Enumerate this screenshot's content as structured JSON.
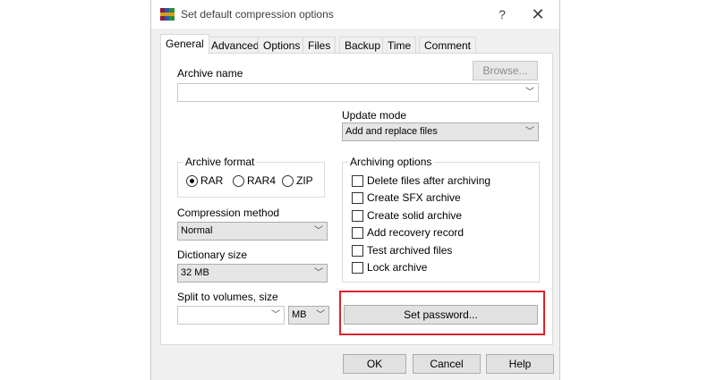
{
  "window": {
    "title": "Set default compression options",
    "help_glyph": "?",
    "close_glyph": "✕",
    "icon": "winrar-books-icon"
  },
  "tabs": [
    {
      "label": "General",
      "active": true
    },
    {
      "label": "Advanced",
      "active": false
    },
    {
      "label": "Options",
      "active": false
    },
    {
      "label": "Files",
      "active": false
    },
    {
      "label": "Backup",
      "active": false
    },
    {
      "label": "Time",
      "active": false
    },
    {
      "label": "Comment",
      "active": false
    }
  ],
  "general": {
    "archive_name_label": "Archive name",
    "archive_name_value": "",
    "browse_label": "Browse...",
    "update_mode_label": "Update mode",
    "update_mode_value": "Add and replace files",
    "archive_format": {
      "title": "Archive format",
      "options": [
        "RAR",
        "RAR4",
        "ZIP"
      ],
      "selected": "RAR"
    },
    "compression_method_label": "Compression method",
    "compression_method_value": "Normal",
    "dictionary_size_label": "Dictionary size",
    "dictionary_size_value": "32 MB",
    "split_label": "Split to volumes, size",
    "split_value": "",
    "split_unit": "MB",
    "archiving_options": {
      "title": "Archiving options",
      "items": [
        {
          "label": "Delete files after archiving",
          "checked": false
        },
        {
          "label": "Create SFX archive",
          "checked": false
        },
        {
          "label": "Create solid archive",
          "checked": false
        },
        {
          "label": "Add recovery record",
          "checked": false
        },
        {
          "label": "Test archived files",
          "checked": false
        },
        {
          "label": "Lock archive",
          "checked": false
        }
      ]
    },
    "set_password_label": "Set password..."
  },
  "footer": {
    "ok_label": "OK",
    "cancel_label": "Cancel",
    "help_label": "Help"
  },
  "colors": {
    "highlight": "#e0202a",
    "dialog_bg": "#f0f0f0",
    "panel_bg": "#ffffff"
  }
}
